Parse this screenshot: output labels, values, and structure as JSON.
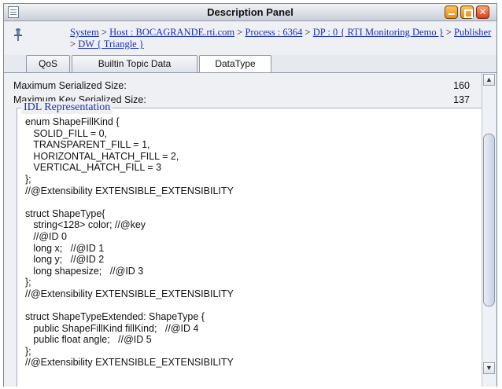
{
  "window": {
    "title": "Description Panel"
  },
  "breadcrumb": {
    "items": [
      "System",
      "Host : BOCAGRANDE.rti.com",
      "Process : 6364",
      "DP : 0 { RTI Monitoring Demo }",
      "Publisher",
      "DW { Triangle }"
    ],
    "separator": ">"
  },
  "tabs": [
    {
      "label": "QoS"
    },
    {
      "label": "Builtin Topic Data"
    },
    {
      "label": "DataType",
      "active": true
    }
  ],
  "properties": [
    {
      "label": "Maximum Serialized Size:",
      "value": "160"
    },
    {
      "label": "Maximum Key Serialized Size:",
      "value": "137"
    }
  ],
  "idl": {
    "legend": "IDL Representation",
    "text": "enum ShapeFillKind {\n   SOLID_FILL = 0,\n   TRANSPARENT_FILL = 1,\n   HORIZONTAL_HATCH_FILL = 2,\n   VERTICAL_HATCH_FILL = 3\n};\n//@Extensibility EXTENSIBLE_EXTENSIBILITY\n\nstruct ShapeType{\n   string<128> color; //@key\n   //@ID 0\n   long x;   //@ID 1\n   long y;   //@ID 2\n   long shapesize;   //@ID 3\n};\n//@Extensibility EXTENSIBLE_EXTENSIBILITY\n\nstruct ShapeTypeExtended: ShapeType {\n   public ShapeFillKind fillKind;   //@ID 4\n   public float angle;   //@ID 5\n};\n//@Extensibility EXTENSIBLE_EXTENSIBILITY"
  },
  "icons": {
    "window": "panel-icon",
    "pin": "pin-icon",
    "minimize": "minimize-icon",
    "maximize": "maximize-icon",
    "close": "close-icon",
    "scroll_up": "arrow-up-icon",
    "scroll_down": "arrow-down-icon"
  },
  "colors": {
    "link": "#1b2fb5",
    "legend": "#1b2fb5",
    "close_button": "#d8401a",
    "window_buttons": "#e88a10"
  }
}
